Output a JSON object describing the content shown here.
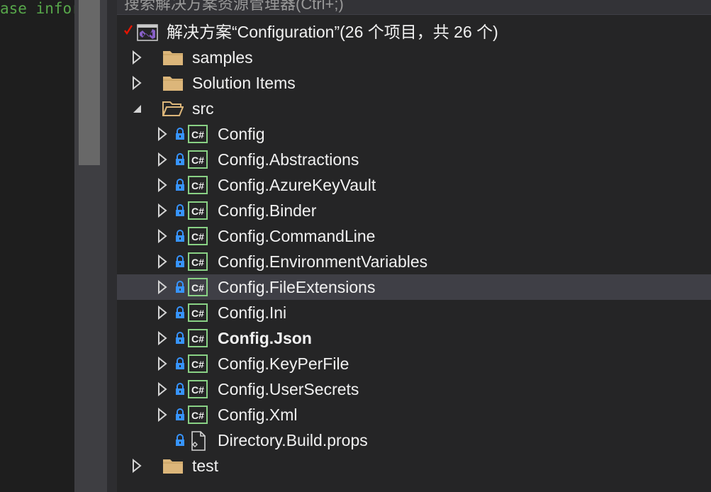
{
  "editor": {
    "code_fragment": "ase infor"
  },
  "search": {
    "placeholder": "搜索解决方案资源管理器(Ctrl+;)"
  },
  "solution": {
    "label": "解决方案“Configuration”(26 个项目，共 26 个)"
  },
  "tree": {
    "samples": "samples",
    "solution_items": "Solution Items",
    "src": "src",
    "projects": [
      "Config",
      "Config.Abstractions",
      "Config.AzureKeyVault",
      "Config.Binder",
      "Config.CommandLine",
      "Config.EnvironmentVariables",
      "Config.FileExtensions",
      "Config.Ini",
      "Config.Json",
      "Config.KeyPerFile",
      "Config.UserSecrets",
      "Config.Xml"
    ],
    "props_file": "Directory.Build.props",
    "test": "test"
  },
  "state": {
    "selected_item": "Config.FileExtensions",
    "startup_project": "Config.Json"
  },
  "colors": {
    "background": "#252526",
    "selection": "#3f3f46",
    "text": "#f1f1f1",
    "folder": "#dcb67a",
    "csharp": "#89d185",
    "lock": "#3794ff",
    "check": "#e51400",
    "vs_purple": "#865fc5"
  }
}
